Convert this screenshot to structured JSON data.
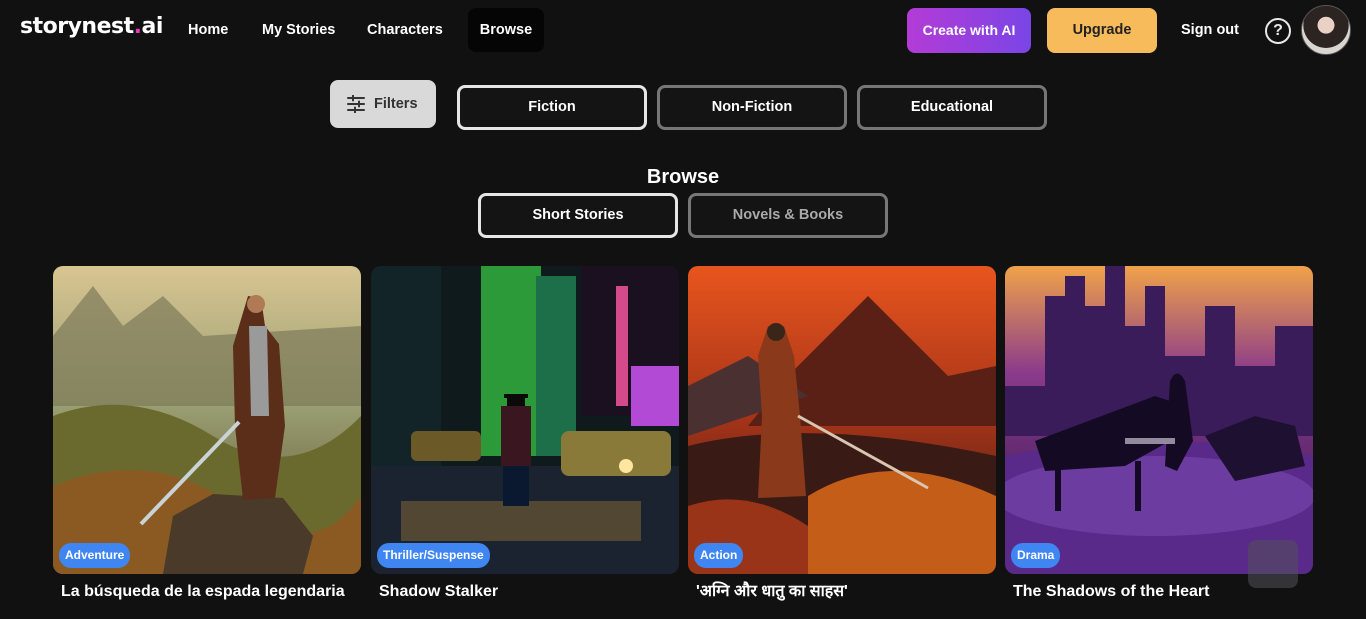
{
  "brand": {
    "name": "storynest",
    "dot": ".",
    "suffix": "ai"
  },
  "nav": {
    "links": [
      {
        "label": "Home"
      },
      {
        "label": "My Stories"
      },
      {
        "label": "Characters"
      },
      {
        "label": "Browse",
        "active": true
      }
    ],
    "create_label": "Create with AI",
    "upgrade_label": "Upgrade",
    "signout_label": "Sign out",
    "help_glyph": "?",
    "help_icon": "help-circle-icon",
    "avatar_icon": "user-avatar"
  },
  "filters": {
    "button_label": "Filters",
    "icon": "sliders-icon",
    "genres": [
      {
        "label": "Fiction",
        "active": true
      },
      {
        "label": "Non-Fiction",
        "active": false
      },
      {
        "label": "Educational",
        "active": false
      }
    ]
  },
  "browse": {
    "title": "Browse",
    "types": [
      {
        "label": "Short Stories",
        "active": true
      },
      {
        "label": "Novels & Books",
        "active": false
      }
    ]
  },
  "stories": [
    {
      "title": "La búsqueda de la espada legendaria",
      "genre": "Adventure"
    },
    {
      "title": "Shadow Stalker",
      "genre": "Thriller/Suspense"
    },
    {
      "title": "'अग्नि और धातु का साहस'",
      "genre": "Action"
    },
    {
      "title": "The Shadows of the Heart",
      "genre": "Drama"
    }
  ],
  "colors": {
    "background": "#111111",
    "accent_purple": "#b43bd6",
    "accent_gold": "#f7bb5c",
    "badge_blue": "#3f86f2",
    "logo_dot": "#e33bb8"
  }
}
